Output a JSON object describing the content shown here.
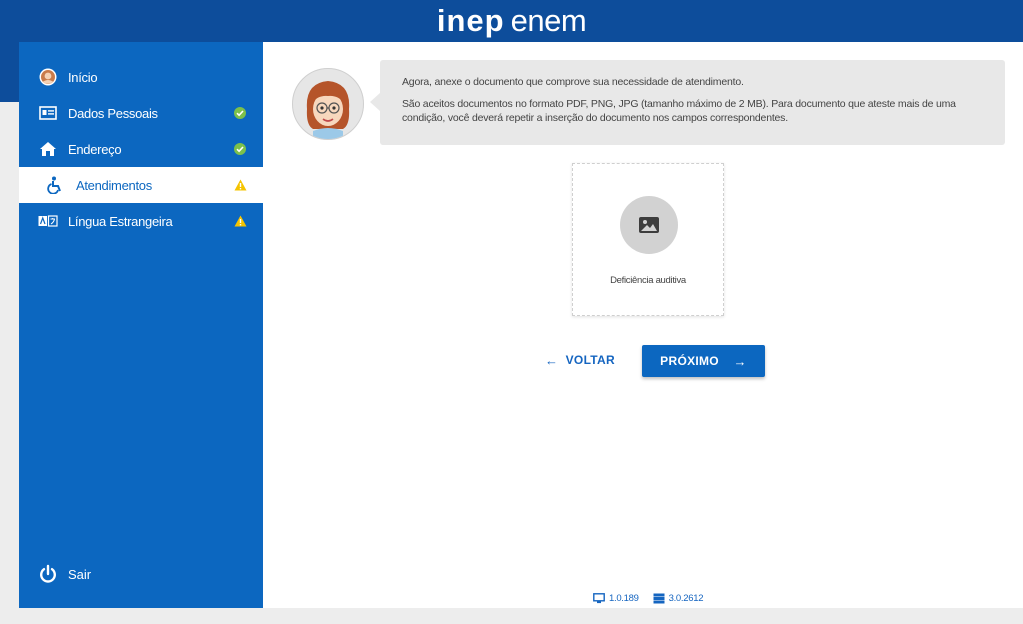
{
  "header": {
    "logo_inep": "inep",
    "logo_enem": "enem"
  },
  "sidebar": {
    "items": [
      {
        "label": "Início",
        "icon": "user-avatar-icon",
        "status": ""
      },
      {
        "label": "Dados Pessoais",
        "icon": "id-card-icon",
        "status": "check"
      },
      {
        "label": "Endereço",
        "icon": "home-icon",
        "status": "check"
      },
      {
        "label": "Atendimentos",
        "icon": "wheelchair-icon",
        "status": "warning",
        "active": true
      },
      {
        "label": "Língua Estrangeira",
        "icon": "translate-icon",
        "status": "warning"
      }
    ],
    "logout_label": "Sair"
  },
  "assistant": {
    "line1": "Agora, anexe o documento que comprove sua necessidade de atendimento.",
    "line2": "São aceitos documentos no formato PDF, PNG, JPG (tamanho máximo de 2 MB). Para documento que ateste mais de uma condição, você deverá repetir a inserção do documento nos campos correspondentes."
  },
  "upload": {
    "label": "Deficiência auditiva",
    "icon": "image-icon"
  },
  "buttons": {
    "back_label": "VOLTAR",
    "next_label": "PRÓXIMO"
  },
  "footer": {
    "client_version": "1.0.189",
    "server_version": "3.0.2612"
  },
  "colors": {
    "primary": "#0c67c0",
    "header": "#0d4d9b",
    "check": "#7cc04b",
    "warning": "#f5c400"
  }
}
